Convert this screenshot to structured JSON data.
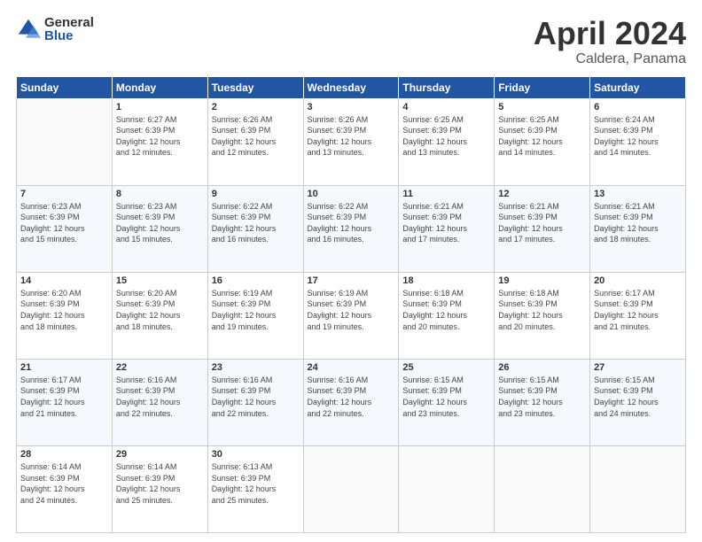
{
  "logo": {
    "general": "General",
    "blue": "Blue"
  },
  "title": "April 2024",
  "subtitle": "Caldera, Panama",
  "headers": [
    "Sunday",
    "Monday",
    "Tuesday",
    "Wednesday",
    "Thursday",
    "Friday",
    "Saturday"
  ],
  "weeks": [
    [
      {
        "day": "",
        "info": ""
      },
      {
        "day": "1",
        "info": "Sunrise: 6:27 AM\nSunset: 6:39 PM\nDaylight: 12 hours\nand 12 minutes."
      },
      {
        "day": "2",
        "info": "Sunrise: 6:26 AM\nSunset: 6:39 PM\nDaylight: 12 hours\nand 12 minutes."
      },
      {
        "day": "3",
        "info": "Sunrise: 6:26 AM\nSunset: 6:39 PM\nDaylight: 12 hours\nand 13 minutes."
      },
      {
        "day": "4",
        "info": "Sunrise: 6:25 AM\nSunset: 6:39 PM\nDaylight: 12 hours\nand 13 minutes."
      },
      {
        "day": "5",
        "info": "Sunrise: 6:25 AM\nSunset: 6:39 PM\nDaylight: 12 hours\nand 14 minutes."
      },
      {
        "day": "6",
        "info": "Sunrise: 6:24 AM\nSunset: 6:39 PM\nDaylight: 12 hours\nand 14 minutes."
      }
    ],
    [
      {
        "day": "7",
        "info": "Sunrise: 6:23 AM\nSunset: 6:39 PM\nDaylight: 12 hours\nand 15 minutes."
      },
      {
        "day": "8",
        "info": "Sunrise: 6:23 AM\nSunset: 6:39 PM\nDaylight: 12 hours\nand 15 minutes."
      },
      {
        "day": "9",
        "info": "Sunrise: 6:22 AM\nSunset: 6:39 PM\nDaylight: 12 hours\nand 16 minutes."
      },
      {
        "day": "10",
        "info": "Sunrise: 6:22 AM\nSunset: 6:39 PM\nDaylight: 12 hours\nand 16 minutes."
      },
      {
        "day": "11",
        "info": "Sunrise: 6:21 AM\nSunset: 6:39 PM\nDaylight: 12 hours\nand 17 minutes."
      },
      {
        "day": "12",
        "info": "Sunrise: 6:21 AM\nSunset: 6:39 PM\nDaylight: 12 hours\nand 17 minutes."
      },
      {
        "day": "13",
        "info": "Sunrise: 6:21 AM\nSunset: 6:39 PM\nDaylight: 12 hours\nand 18 minutes."
      }
    ],
    [
      {
        "day": "14",
        "info": "Sunrise: 6:20 AM\nSunset: 6:39 PM\nDaylight: 12 hours\nand 18 minutes."
      },
      {
        "day": "15",
        "info": "Sunrise: 6:20 AM\nSunset: 6:39 PM\nDaylight: 12 hours\nand 18 minutes."
      },
      {
        "day": "16",
        "info": "Sunrise: 6:19 AM\nSunset: 6:39 PM\nDaylight: 12 hours\nand 19 minutes."
      },
      {
        "day": "17",
        "info": "Sunrise: 6:19 AM\nSunset: 6:39 PM\nDaylight: 12 hours\nand 19 minutes."
      },
      {
        "day": "18",
        "info": "Sunrise: 6:18 AM\nSunset: 6:39 PM\nDaylight: 12 hours\nand 20 minutes."
      },
      {
        "day": "19",
        "info": "Sunrise: 6:18 AM\nSunset: 6:39 PM\nDaylight: 12 hours\nand 20 minutes."
      },
      {
        "day": "20",
        "info": "Sunrise: 6:17 AM\nSunset: 6:39 PM\nDaylight: 12 hours\nand 21 minutes."
      }
    ],
    [
      {
        "day": "21",
        "info": "Sunrise: 6:17 AM\nSunset: 6:39 PM\nDaylight: 12 hours\nand 21 minutes."
      },
      {
        "day": "22",
        "info": "Sunrise: 6:16 AM\nSunset: 6:39 PM\nDaylight: 12 hours\nand 22 minutes."
      },
      {
        "day": "23",
        "info": "Sunrise: 6:16 AM\nSunset: 6:39 PM\nDaylight: 12 hours\nand 22 minutes."
      },
      {
        "day": "24",
        "info": "Sunrise: 6:16 AM\nSunset: 6:39 PM\nDaylight: 12 hours\nand 22 minutes."
      },
      {
        "day": "25",
        "info": "Sunrise: 6:15 AM\nSunset: 6:39 PM\nDaylight: 12 hours\nand 23 minutes."
      },
      {
        "day": "26",
        "info": "Sunrise: 6:15 AM\nSunset: 6:39 PM\nDaylight: 12 hours\nand 23 minutes."
      },
      {
        "day": "27",
        "info": "Sunrise: 6:15 AM\nSunset: 6:39 PM\nDaylight: 12 hours\nand 24 minutes."
      }
    ],
    [
      {
        "day": "28",
        "info": "Sunrise: 6:14 AM\nSunset: 6:39 PM\nDaylight: 12 hours\nand 24 minutes."
      },
      {
        "day": "29",
        "info": "Sunrise: 6:14 AM\nSunset: 6:39 PM\nDaylight: 12 hours\nand 25 minutes."
      },
      {
        "day": "30",
        "info": "Sunrise: 6:13 AM\nSunset: 6:39 PM\nDaylight: 12 hours\nand 25 minutes."
      },
      {
        "day": "",
        "info": ""
      },
      {
        "day": "",
        "info": ""
      },
      {
        "day": "",
        "info": ""
      },
      {
        "day": "",
        "info": ""
      }
    ]
  ]
}
